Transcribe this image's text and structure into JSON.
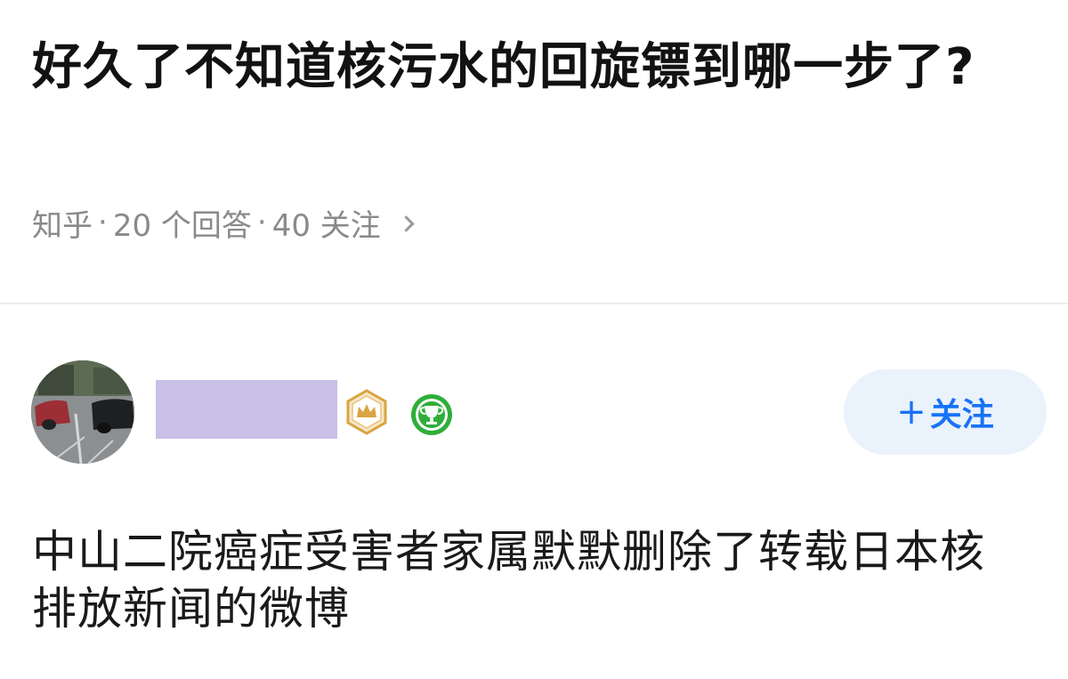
{
  "question": {
    "title": "好久了不知道核污水的回旋镖到哪一步了?",
    "source": "知乎",
    "answers_count": "20 个回答",
    "followers_count": "40 关注",
    "separator": "·"
  },
  "answer": {
    "author": {
      "avatar_icon": "avatar-photo-cars",
      "badges": [
        "crown-badge-icon",
        "trophy-badge-icon"
      ]
    },
    "follow_label": "关注",
    "follow_prefix": "+",
    "content": "中山二院癌症受害者家属默默删除了转载日本核排放新闻的微博"
  },
  "colors": {
    "accent": "#1772f6",
    "follow_bg": "#eaf2fc",
    "meta_text": "#8a8a8a",
    "redacted_name": "#c8c0e6",
    "badge_gold": "#d9a441",
    "badge_green": "#2fae3a"
  }
}
